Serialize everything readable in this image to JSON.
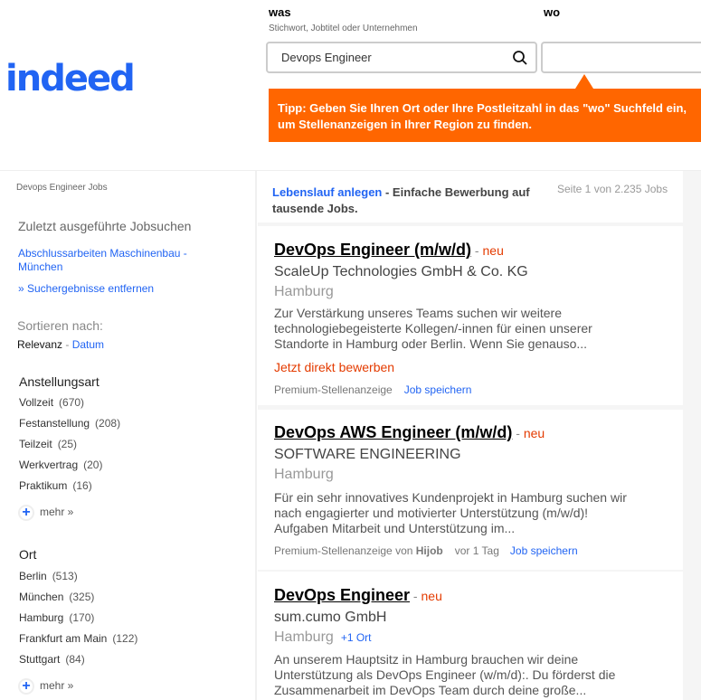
{
  "header": {
    "logo": "indeed",
    "what_label": "was",
    "what_hint": "Stichwort, Jobtitel oder Unternehmen",
    "what_value": "Devops Engineer",
    "where_label": "wo",
    "where_value": "",
    "tip": "Tipp: Geben Sie Ihren Ort oder Ihre Postleitzahl in das \"wo\" Suchfeld ein, um Stellenanzeigen in Ihrer Region zu finden."
  },
  "sidebar": {
    "breadcrumb": "Devops Engineer Jobs",
    "recent_heading": "Zuletzt ausgeführte Jobsuchen",
    "recent_link": "Abschlussarbeiten Maschinenbau - München",
    "remove_link": "» Suchergebnisse entfernen",
    "sort_heading": "Sortieren nach:",
    "sort_relevance": "Relevanz",
    "sort_sep": " - ",
    "sort_date": "Datum",
    "employment": {
      "heading": "Anstellungsart",
      "items": [
        {
          "label": "Vollzeit",
          "count": "(670)"
        },
        {
          "label": "Festanstellung",
          "count": "(208)"
        },
        {
          "label": "Teilzeit",
          "count": "(25)"
        },
        {
          "label": "Werkvertrag",
          "count": "(20)"
        },
        {
          "label": "Praktikum",
          "count": "(16)"
        }
      ],
      "more": "mehr »"
    },
    "location": {
      "heading": "Ort",
      "items": [
        {
          "label": "Berlin",
          "count": "(513)"
        },
        {
          "label": "München",
          "count": "(325)"
        },
        {
          "label": "Hamburg",
          "count": "(170)"
        },
        {
          "label": "Frankfurt am Main",
          "count": "(122)"
        },
        {
          "label": "Stuttgart",
          "count": "(84)"
        }
      ],
      "more": "mehr »"
    }
  },
  "main": {
    "resume_link": "Lebenslauf anlegen",
    "resume_text": " - Einfache Bewerbung auf tausende Jobs.",
    "page_info": "Seite 1 von 2.235 Jobs",
    "jobs": [
      {
        "title": "DevOps Engineer (m/w/d)",
        "new": "neu",
        "company": "ScaleUp Technologies GmbH & Co. KG",
        "location": "Hamburg",
        "description": "Zur Verstärkung unseres Teams suchen wir weitere technologiebegeisterte Kollegen/-innen für einen unserer Standorte in Hamburg oder Berlin. Wenn Sie genauso...",
        "apply": "Jetzt direkt bewerben",
        "sponsored": "Premium-Stellenanzeige",
        "save": "Job speichern"
      },
      {
        "title": "DevOps AWS Engineer (m/w/d)",
        "new": "neu",
        "company": "SOFTWARE ENGINEERING",
        "location": "Hamburg",
        "description": "Für ein sehr innovatives Kundenprojekt in Hamburg suchen wir nach engagierter und motivierter Unterstützung (m/w/d)! Aufgaben Mitarbeit und Unterstützung im...",
        "sponsored": "Premium-Stellenanzeige von ",
        "sponsor": "Hijob",
        "age": "vor 1 Tag",
        "save": "Job speichern"
      },
      {
        "title": "DevOps Engineer",
        "new": "neu",
        "company": "sum.cumo GmbH",
        "location": "Hamburg",
        "more_locations": "+1 Ort",
        "description": "An unserem Hauptsitz in Hamburg brauchen wir deine Unterstützung als DevOps Engineer (w/m/d):. Du förderst die Zusammenarbeit im DevOps Team durch deine große..."
      }
    ]
  }
}
